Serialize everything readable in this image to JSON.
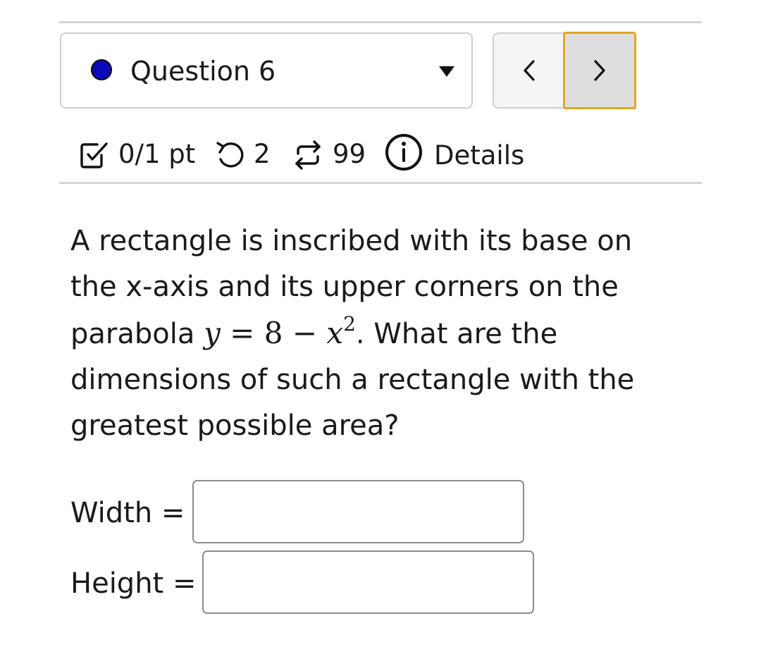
{
  "question_nav": {
    "title": "Question 6",
    "status_dot_color": "#0a0ab8",
    "dropdown_icon": "caret-down-icon",
    "prev_icon": "chevron-left-icon",
    "next_icon": "chevron-right-icon",
    "focus_color": "#e0a81e"
  },
  "status": {
    "score": "0/1 pt",
    "score_icon": "checkbox-icon",
    "retries": "2",
    "retries_icon": "undo-icon",
    "attempts": "99",
    "attempts_icon": "repeat-icon",
    "details_label": "Details",
    "details_icon": "info-icon"
  },
  "question": {
    "line1": "A rectangle is inscribed with its base on",
    "line2": "the x-axis and its upper corners on the",
    "line3_before": "parabola ",
    "math": {
      "y": "y",
      "eq": "=",
      "eight": "8",
      "minus": "−",
      "x": "x",
      "exp": "2"
    },
    "line3_after": ". What are the",
    "line4": "dimensions of such a rectangle with the",
    "line5": "greatest possible area?"
  },
  "answers": {
    "width_label": "Width =",
    "width_value": "",
    "height_label": "Height =",
    "height_value": ""
  }
}
